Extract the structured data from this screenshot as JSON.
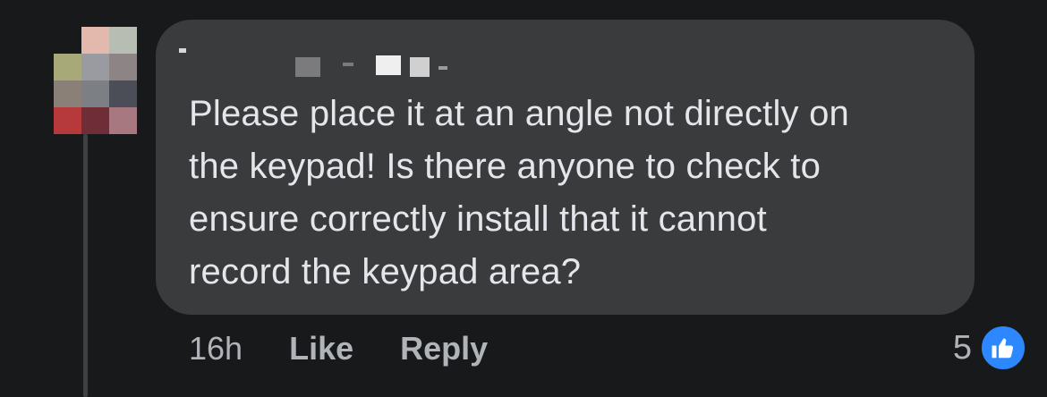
{
  "comment": {
    "author_redacted": true,
    "text": "Please place it at an angle not directly on\nthe keypad! Is there anyone to check to\nensure correctly install that it cannot\nrecord the keypad area?",
    "timestamp": "16h",
    "like_label": "Like",
    "reply_label": "Reply",
    "reaction_count": "5",
    "reaction_icon": "thumbs-up-icon"
  },
  "colors": {
    "background": "#18191a",
    "bubble": "#3a3b3c",
    "text": "#e4e6eb",
    "secondary_text": "#b0b3b8",
    "like_blue": "#2d88ff"
  }
}
